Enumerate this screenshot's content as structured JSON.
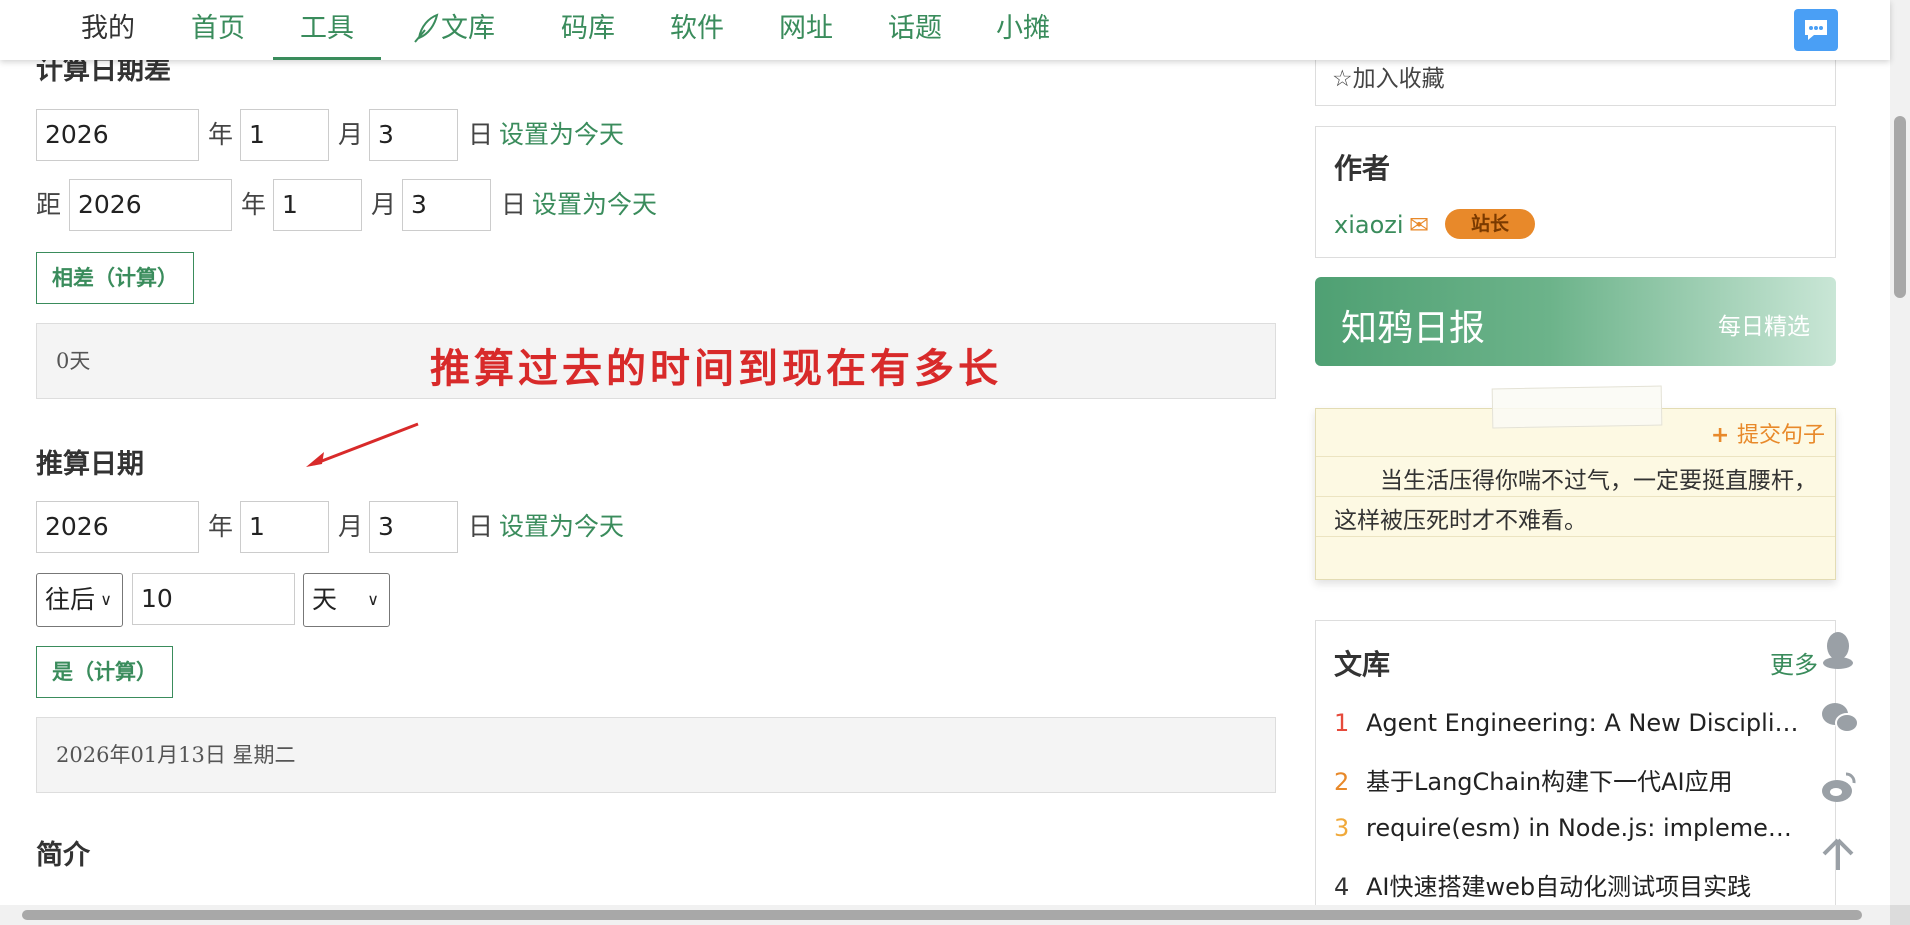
{
  "nav": {
    "items": [
      "我的",
      "首页",
      "工具",
      "文库",
      "码库",
      "软件",
      "网址",
      "话题",
      "小摊"
    ],
    "active": "工具"
  },
  "calc_diff": {
    "title": "计算日期差",
    "row1": {
      "year": "2026",
      "month": "1",
      "day": "3",
      "set_today": "设置为今天"
    },
    "row2": {
      "prefix": "距",
      "year": "2026",
      "month": "1",
      "day": "3",
      "set_today": "设置为今天"
    },
    "units": {
      "year": "年",
      "month": "月",
      "day": "日"
    },
    "button": "相差（计算）",
    "result": "0天"
  },
  "annotation": "推算过去的时间到现在有多长",
  "infer_date": {
    "title": "推算日期",
    "row": {
      "year": "2026",
      "month": "1",
      "day": "3",
      "set_today": "设置为今天"
    },
    "direction": "往后",
    "amount": "10",
    "unit": "天",
    "button": "是（计算）",
    "result": "2026年01月13日  星期二"
  },
  "intro_title": "简介",
  "sidebar": {
    "favorite": "加入收藏",
    "author_title": "作者",
    "author_name": "xiaozi",
    "author_badge": "站长",
    "daily_title": "知鸦日报",
    "daily_sub": "每日精选",
    "submit_sentence": "提交句子",
    "quote": "当生活压得你喘不过气，一定要挺直腰杆，这样被压死时才不难看。",
    "library_title": "文库",
    "library_more": "更多",
    "library_items": [
      {
        "num": "1",
        "title": "Agent Engineering: A New Discipli…"
      },
      {
        "num": "2",
        "title": "基于LangChain构建下一代AI应用"
      },
      {
        "num": "3",
        "title": "require(esm) in Node.js: impleme…"
      },
      {
        "num": "4",
        "title": "AI快速搭建web自动化测试项目实践"
      }
    ]
  },
  "colors": {
    "accent": "#3a8c5c",
    "badge": "#e8892a",
    "annotation": "#d82a2a",
    "chat": "#4a9ff5"
  }
}
